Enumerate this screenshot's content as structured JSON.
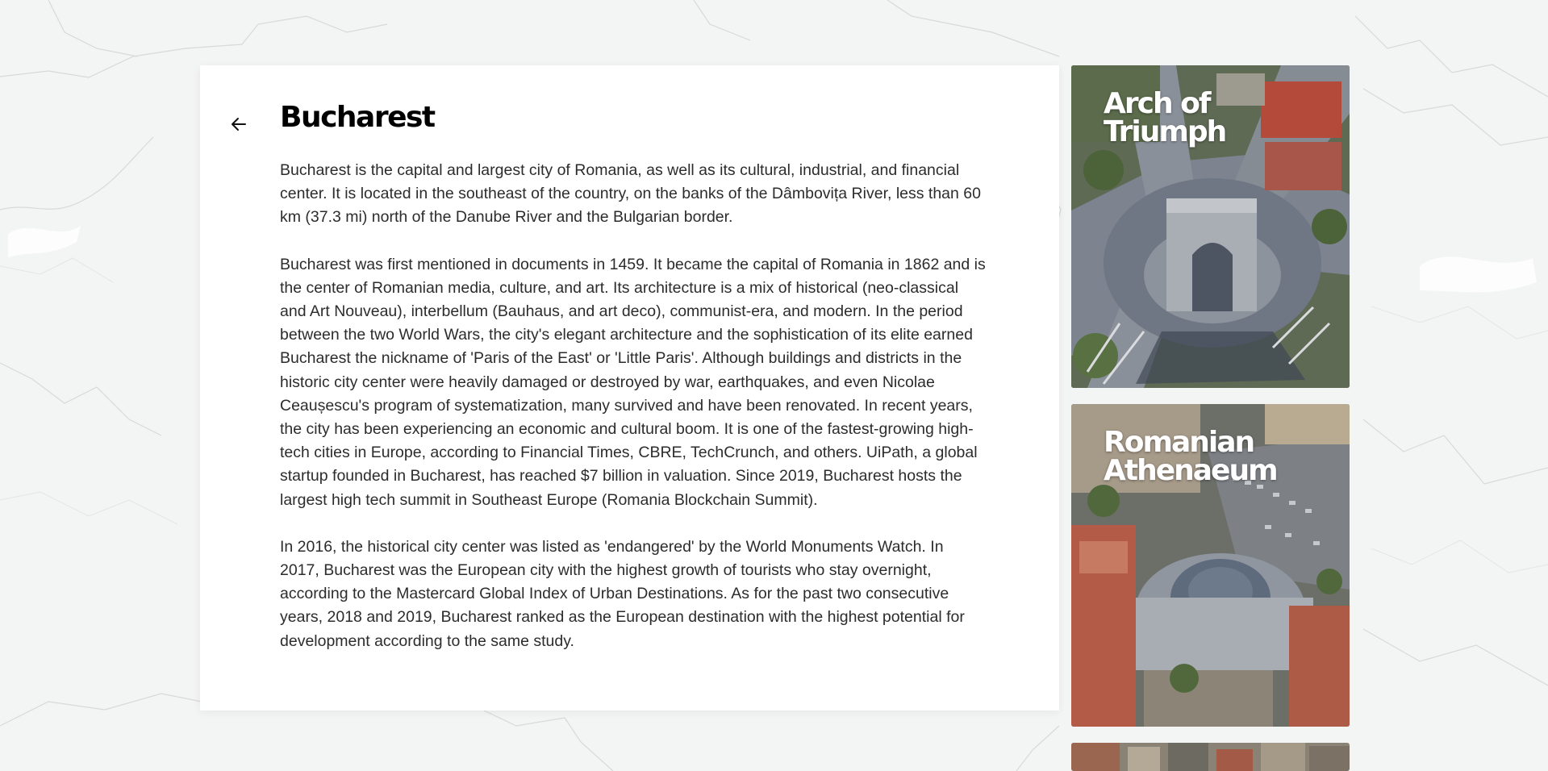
{
  "page": {
    "title": "Bucharest",
    "paragraphs": [
      "Bucharest is the capital and largest city of Romania, as well as its cultural, industrial, and financial center. It is located in the southeast of the country, on the banks of the Dâmbovița River, less than 60 km (37.3 mi) north of the Danube River and the Bulgarian border.",
      "Bucharest was first mentioned in documents in 1459. It became the capital of Romania in 1862 and is the center of Romanian media, culture, and art. Its architecture is a mix of historical (neo-classical and Art Nouveau), interbellum (Bauhaus, and art deco), communist-era, and modern. In the period between the two World Wars, the city's elegant architecture and the sophistication of its elite earned Bucharest the nickname of 'Paris of the East' or 'Little Paris'. Although buildings and districts in the historic city center were heavily damaged or destroyed by war, earthquakes, and even Nicolae Ceaușescu's program of systematization, many survived and have been renovated. In recent years, the city has been experiencing an economic and cultural boom. It is one of the fastest-growing high-tech cities in Europe, according to Financial Times, CBRE, TechCrunch, and others. UiPath, a global startup founded in Bucharest, has reached $7 billion in valuation. Since 2019, Bucharest hosts the largest high tech summit in Southeast Europe (Romania Blockchain Summit).",
      "In 2016, the historical city center was listed as 'endangered' by the World Monuments Watch. In 2017, Bucharest was the European city with the highest growth of tourists who stay overnight, according to the Mastercard Global Index of Urban Destinations. As for the past two consecutive years, 2018 and 2019, Bucharest ranked as the European destination with the highest potential for development according to the same study."
    ]
  },
  "back_button": {
    "icon": "arrow-left-icon"
  },
  "places": [
    {
      "title": "Arch of Triumph",
      "image": "arch-of-triumph-aerial-image"
    },
    {
      "title": "Romanian Athenaeum",
      "image": "romanian-athenaeum-aerial-image"
    },
    {
      "title": "",
      "image": "city-aerial-image"
    }
  ],
  "colors": {
    "background": "#f3f4f4",
    "card": "#ffffff",
    "text": "#2c2c2c",
    "title": "#000000"
  }
}
